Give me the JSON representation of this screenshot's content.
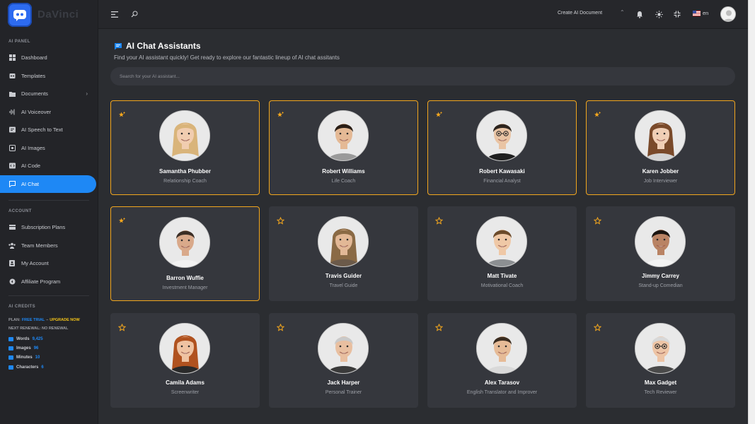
{
  "app": {
    "logo_text": "DaVinci"
  },
  "sidebar": {
    "section_ai": "AI PANEL",
    "items_ai": [
      {
        "label": "Dashboard",
        "icon": "dashboard-icon"
      },
      {
        "label": "Templates",
        "icon": "templates-icon"
      },
      {
        "label": "Documents",
        "icon": "folder-icon",
        "has_children": true
      },
      {
        "label": "AI Voiceover",
        "icon": "waveform-icon"
      },
      {
        "label": "AI Speech to Text",
        "icon": "speech-icon"
      },
      {
        "label": "AI Images",
        "icon": "image-icon"
      },
      {
        "label": "AI Code",
        "icon": "code-icon"
      },
      {
        "label": "AI Chat",
        "icon": "chat-icon",
        "active": true
      }
    ],
    "section_account": "ACCOUNT",
    "items_account": [
      {
        "label": "Subscription Plans",
        "icon": "plans-icon"
      },
      {
        "label": "Team Members",
        "icon": "team-icon"
      },
      {
        "label": "My Account",
        "icon": "account-icon"
      },
      {
        "label": "Affiliate Program",
        "icon": "affiliate-icon"
      }
    ],
    "section_credits": "AI CREDITS",
    "plan_prefix": "PLAN:",
    "plan_value": "FREE TRIAL",
    "plan_dash": "–",
    "upgrade_label": "UPGRADE NOW",
    "renewal_text": "NEXT RENEWAL: NO RENEWAL",
    "credits": [
      {
        "label": "Words",
        "value": "9,425"
      },
      {
        "label": "Images",
        "value": "96"
      },
      {
        "label": "Minutes",
        "value": "10"
      },
      {
        "label": "Characters",
        "value": "6"
      }
    ]
  },
  "topbar": {
    "create_label": "Create AI Document",
    "lang": "en"
  },
  "main": {
    "title": "AI Chat Assistants",
    "subtitle": "Find your AI assistant quickly! Get ready to explore our fantastic lineup of AI chat assitants",
    "search_placeholder": "Search for your AI assistant..."
  },
  "assistants": [
    {
      "name": "Samantha Phubber",
      "role": "Relationship Coach",
      "favorite": true
    },
    {
      "name": "Robert Williams",
      "role": "Life Coach",
      "favorite": true
    },
    {
      "name": "Robert Kawasaki",
      "role": "Financial Analyst",
      "favorite": true
    },
    {
      "name": "Karen Jobber",
      "role": "Job Interviewer",
      "favorite": true
    },
    {
      "name": "Barron Wuffie",
      "role": "Investment Manager",
      "favorite": true
    },
    {
      "name": "Travis Guider",
      "role": "Travel Guide",
      "favorite": false
    },
    {
      "name": "Matt Tivate",
      "role": "Motivational Coach",
      "favorite": false
    },
    {
      "name": "Jimmy Carrey",
      "role": "Stand-up Comedian",
      "favorite": false
    },
    {
      "name": "Camila Adams",
      "role": "Screenwriter",
      "favorite": false
    },
    {
      "name": "Jack Harper",
      "role": "Personal Trainer",
      "favorite": false
    },
    {
      "name": "Alex Tarasov",
      "role": "English Translator and Improver",
      "favorite": false
    },
    {
      "name": "Max Gadget",
      "role": "Tech Reviewer",
      "favorite": false
    }
  ],
  "colors": {
    "accent": "#1e88f5",
    "favorite_border": "#f2a61e",
    "card_bg": "#35373d"
  }
}
